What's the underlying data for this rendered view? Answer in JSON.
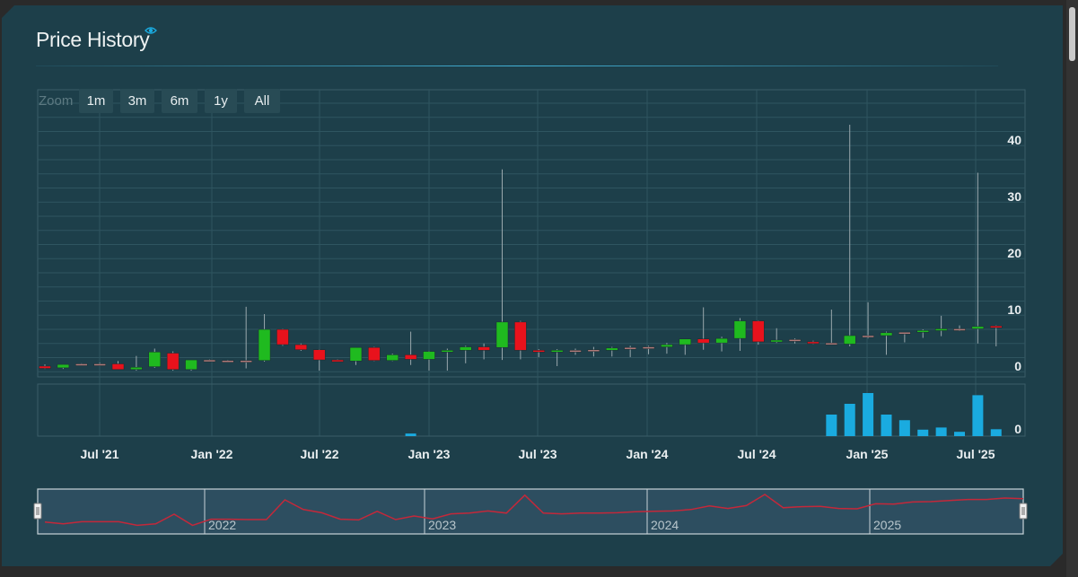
{
  "header": {
    "title": "Price History"
  },
  "zoom": {
    "label": "Zoom",
    "buttons": [
      "1m",
      "3m",
      "6m",
      "1y",
      "All"
    ]
  },
  "colors": {
    "up": "#1fba1f",
    "down": "#e8121c",
    "flat": "#b07a7a",
    "volume": "#1aabe0",
    "navigator_line": "#c4283a"
  },
  "chart_data": {
    "type": "candlestick",
    "x_ticks": [
      "Jul '21",
      "Jan '22",
      "Jul '22",
      "Jan '23",
      "Jul '23",
      "Jan '24",
      "Jul '24",
      "Jan '25",
      "Jul '25"
    ],
    "y_ticks": [
      0,
      10,
      20,
      30,
      40
    ],
    "volume_ticks": [
      0
    ],
    "navigator_labels": [
      "2022",
      "2023",
      "2024",
      "2025"
    ],
    "ohlc": [
      {
        "date": "2021-05",
        "o": 0.0,
        "h": 0.3,
        "l": -0.5,
        "c": -0.4
      },
      {
        "date": "2021-06",
        "o": -0.3,
        "h": 0.3,
        "l": -0.5,
        "c": 0.3
      },
      {
        "date": "2021-07",
        "o": 0.4,
        "h": 0.5,
        "l": 0.2,
        "c": 0.4
      },
      {
        "date": "2021-08",
        "o": 0.4,
        "h": 0.6,
        "l": 0.3,
        "c": 0.4
      },
      {
        "date": "2021-09",
        "o": 0.4,
        "h": 0.9,
        "l": -0.6,
        "c": -0.6
      },
      {
        "date": "2021-10",
        "o": -0.6,
        "h": 1.8,
        "l": -0.8,
        "c": -0.2
      },
      {
        "date": "2021-11",
        "o": -0.1,
        "h": 3.1,
        "l": -0.3,
        "c": 2.5
      },
      {
        "date": "2021-12",
        "o": 2.3,
        "h": 2.6,
        "l": -0.8,
        "c": -0.6
      },
      {
        "date": "2022-01",
        "o": -0.6,
        "h": 1.1,
        "l": -0.8,
        "c": 1.1
      },
      {
        "date": "2022-02",
        "o": 1.1,
        "h": 1.2,
        "l": 1.0,
        "c": 1.1
      },
      {
        "date": "2022-03",
        "o": 1.0,
        "h": 1.1,
        "l": 0.9,
        "c": 1.0
      },
      {
        "date": "2022-04",
        "o": 1.0,
        "h": 10.5,
        "l": -0.4,
        "c": 1.0
      },
      {
        "date": "2022-05",
        "o": 1.0,
        "h": 9.2,
        "l": 0.8,
        "c": 6.5
      },
      {
        "date": "2022-06",
        "o": 6.5,
        "h": 6.6,
        "l": 3.6,
        "c": 3.8
      },
      {
        "date": "2022-07",
        "o": 3.8,
        "h": 4.0,
        "l": 2.7,
        "c": 2.9
      },
      {
        "date": "2022-08",
        "o": 2.9,
        "h": 3.0,
        "l": -0.8,
        "c": 1.1
      },
      {
        "date": "2022-09",
        "o": 1.1,
        "h": 1.2,
        "l": 0.8,
        "c": 0.9
      },
      {
        "date": "2022-10",
        "o": 0.9,
        "h": 3.3,
        "l": 0.2,
        "c": 3.3
      },
      {
        "date": "2022-11",
        "o": 3.3,
        "h": 3.4,
        "l": 0.9,
        "c": 1.0
      },
      {
        "date": "2022-12",
        "o": 1.0,
        "h": 2.2,
        "l": 0.9,
        "c": 2.0
      },
      {
        "date": "2022-13",
        "o": 2.0,
        "h": 6.1,
        "l": 0.2,
        "c": 1.2
      },
      {
        "date": "2023-02",
        "o": 1.2,
        "h": 2.7,
        "l": -0.8,
        "c": 2.6
      },
      {
        "date": "2023-03",
        "o": 2.6,
        "h": 3.1,
        "l": -0.8,
        "c": 2.8
      },
      {
        "date": "2023-04",
        "o": 2.8,
        "h": 3.6,
        "l": 0.5,
        "c": 3.4
      },
      {
        "date": "2023-05",
        "o": 3.4,
        "h": 4.0,
        "l": 1.2,
        "c": 2.8
      },
      {
        "date": "2023-06",
        "o": 3.3,
        "h": 34.8,
        "l": 1.1,
        "c": 7.8
      },
      {
        "date": "2023-07",
        "o": 7.8,
        "h": 8.0,
        "l": 1.2,
        "c": 2.8
      },
      {
        "date": "2023-08",
        "o": 2.8,
        "h": 3.0,
        "l": 1.6,
        "c": 2.6
      },
      {
        "date": "2023-09",
        "o": 2.6,
        "h": 3.0,
        "l": 0.0,
        "c": 2.8
      },
      {
        "date": "2023-10",
        "o": 2.8,
        "h": 3.1,
        "l": 2.0,
        "c": 2.8
      },
      {
        "date": "2023-11",
        "o": 2.8,
        "h": 3.4,
        "l": 1.7,
        "c": 2.9
      },
      {
        "date": "2023-12",
        "o": 2.8,
        "h": 3.4,
        "l": 1.7,
        "c": 3.2
      },
      {
        "date": "2024-01",
        "o": 3.2,
        "h": 3.6,
        "l": 1.6,
        "c": 3.3
      },
      {
        "date": "2024-02",
        "o": 3.3,
        "h": 3.6,
        "l": 2.1,
        "c": 3.4
      },
      {
        "date": "2024-03",
        "o": 3.4,
        "h": 4.1,
        "l": 2.2,
        "c": 3.8
      },
      {
        "date": "2024-04",
        "o": 3.8,
        "h": 4.8,
        "l": 2.0,
        "c": 4.8
      },
      {
        "date": "2024-05",
        "o": 4.8,
        "h": 10.4,
        "l": 2.9,
        "c": 4.1
      },
      {
        "date": "2024-06",
        "o": 4.1,
        "h": 5.2,
        "l": 2.6,
        "c": 4.9
      },
      {
        "date": "2024-07",
        "o": 4.9,
        "h": 8.5,
        "l": 2.7,
        "c": 8.0
      },
      {
        "date": "2024-08",
        "o": 8.0,
        "h": 8.1,
        "l": 3.8,
        "c": 4.3
      },
      {
        "date": "2024-09",
        "o": 4.4,
        "h": 6.7,
        "l": 4.1,
        "c": 4.6
      },
      {
        "date": "2024-10",
        "o": 4.6,
        "h": 4.9,
        "l": 4.0,
        "c": 4.7
      },
      {
        "date": "2024-11",
        "o": 4.3,
        "h": 4.5,
        "l": 3.9,
        "c": 4.1
      },
      {
        "date": "2024-12",
        "o": 4.1,
        "h": 10.0,
        "l": 3.8,
        "c": 4.0
      },
      {
        "date": "2025-01",
        "o": 3.9,
        "h": 42.7,
        "l": 3.5,
        "c": 5.4
      },
      {
        "date": "2025-02",
        "o": 5.4,
        "h": 11.3,
        "l": 4.9,
        "c": 5.3
      },
      {
        "date": "2025-03",
        "o": 5.4,
        "h": 6.1,
        "l": 2.0,
        "c": 5.9
      },
      {
        "date": "2025-04",
        "o": 5.9,
        "h": 6.0,
        "l": 4.2,
        "c": 6.0
      },
      {
        "date": "2025-05",
        "o": 6.0,
        "h": 6.5,
        "l": 5.0,
        "c": 6.3
      },
      {
        "date": "2025-06",
        "o": 6.3,
        "h": 8.9,
        "l": 5.3,
        "c": 6.6
      },
      {
        "date": "2025-07",
        "o": 6.5,
        "h": 7.2,
        "l": 6.2,
        "c": 6.6
      },
      {
        "date": "2025-08",
        "o": 6.6,
        "h": 34.2,
        "l": 4.0,
        "c": 7.0
      },
      {
        "date": "2025-09",
        "o": 7.1,
        "h": 7.2,
        "l": 3.5,
        "c": 6.8
      }
    ],
    "volume": [
      0,
      0,
      0,
      0,
      0,
      0,
      0,
      0,
      0,
      0,
      0,
      0,
      0,
      0,
      0,
      0,
      0,
      0,
      0,
      0,
      0.06,
      0,
      0,
      0,
      0,
      0,
      0,
      0,
      0,
      0,
      0,
      0,
      0,
      0,
      0,
      0,
      0,
      0,
      0,
      0,
      0,
      0,
      0,
      0.5,
      0.75,
      1.0,
      0.5,
      0.37,
      0.15,
      0.2,
      0.1,
      0.95,
      0.16
    ],
    "navigator_line": [
      0.3,
      -0.2,
      0.4,
      0.4,
      0.4,
      -0.6,
      -0.2,
      2.5,
      -0.6,
      1.1,
      1.1,
      1.0,
      1.0,
      6.5,
      3.8,
      2.9,
      1.1,
      0.9,
      3.3,
      1.0,
      2.0,
      1.2,
      2.6,
      2.8,
      3.4,
      2.8,
      7.8,
      2.8,
      2.6,
      2.8,
      2.8,
      2.9,
      3.2,
      3.3,
      3.4,
      3.8,
      4.8,
      4.1,
      4.9,
      8.0,
      4.3,
      4.6,
      4.7,
      4.1,
      4.0,
      5.4,
      5.3,
      5.9,
      6.0,
      6.3,
      6.6,
      6.6,
      7.0,
      6.8
    ]
  }
}
